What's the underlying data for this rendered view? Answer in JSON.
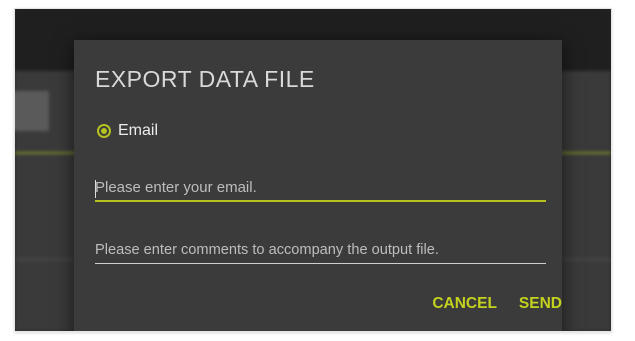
{
  "dialog": {
    "title": "EXPORT DATA FILE",
    "radio_label": "Email",
    "email_placeholder": "Please enter your email.",
    "comments_placeholder": "Please enter comments to accompany the output file.",
    "cancel_label": "CANCEL",
    "send_label": "SEND"
  },
  "colors": {
    "accent": "#c4d21e",
    "dialog_bg": "#3b3b3b",
    "text": "#d9d9d9"
  }
}
